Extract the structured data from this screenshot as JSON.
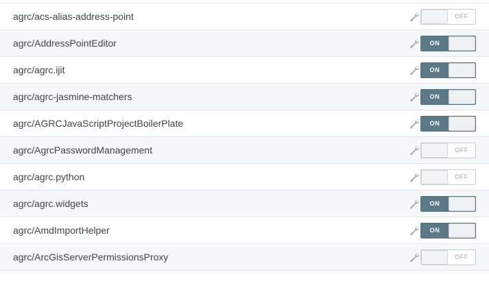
{
  "repositories": [
    {
      "name": "agrc/acs-alias-address-point",
      "enabled": false,
      "toggle_label": "OFF"
    },
    {
      "name": "agrc/AddressPointEditor",
      "enabled": true,
      "toggle_label": "ON"
    },
    {
      "name": "agrc/agrc.ijit",
      "enabled": true,
      "toggle_label": "ON"
    },
    {
      "name": "agrc/agrc-jasmine-matchers",
      "enabled": true,
      "toggle_label": "ON"
    },
    {
      "name": "agrc/AGRCJavaScriptProjectBoilerPlate",
      "enabled": true,
      "toggle_label": "ON"
    },
    {
      "name": "agrc/AgrcPasswordManagement",
      "enabled": false,
      "toggle_label": "OFF"
    },
    {
      "name": "agrc/agrc.python",
      "enabled": false,
      "toggle_label": "OFF"
    },
    {
      "name": "agrc/agrc.widgets",
      "enabled": true,
      "toggle_label": "ON"
    },
    {
      "name": "agrc/AmdImportHelper",
      "enabled": true,
      "toggle_label": "ON"
    },
    {
      "name": "agrc/ArcGisServerPermissionsProxy",
      "enabled": false,
      "toggle_label": "OFF"
    }
  ],
  "icons": {
    "settings": "wrench-icon"
  },
  "colors": {
    "toggle_on": "#5b7986",
    "row_stripe": "#f6f7f8",
    "text": "#3f4347"
  }
}
